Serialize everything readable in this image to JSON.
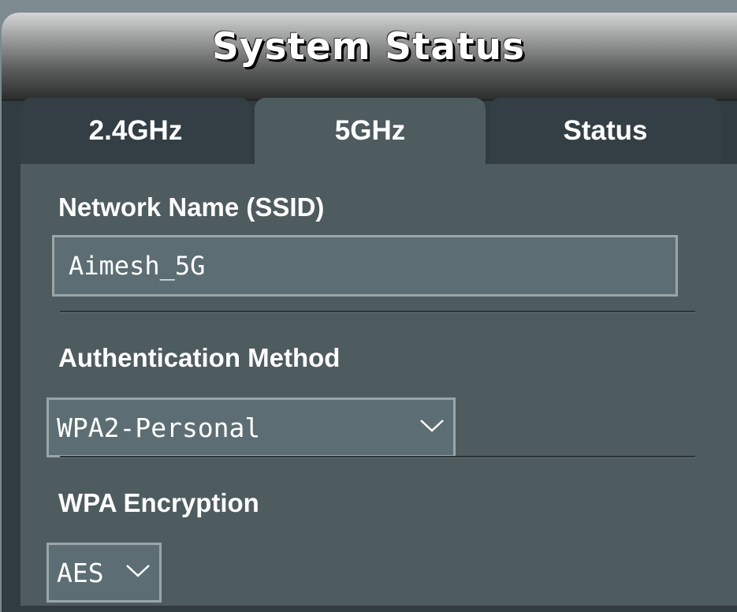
{
  "header": {
    "title": "System Status"
  },
  "tabs": [
    {
      "label": "2.4GHz",
      "active": false
    },
    {
      "label": "5GHz",
      "active": true
    },
    {
      "label": "Status",
      "active": false
    }
  ],
  "form": {
    "ssid": {
      "label": "Network Name (SSID)",
      "value": "Aimesh_5G"
    },
    "auth": {
      "label": "Authentication Method",
      "value": "WPA2-Personal"
    },
    "wpa": {
      "label": "WPA Encryption",
      "value": "AES"
    }
  },
  "icons": {
    "dropdown": "chevron-down-icon"
  },
  "colors": {
    "background": "#7d8a8f",
    "panel": "#313c40",
    "content": "#4e5b5f",
    "input_fill": "#5c6e73",
    "input_border": "#9aa6a9",
    "text": "#ffffff"
  }
}
